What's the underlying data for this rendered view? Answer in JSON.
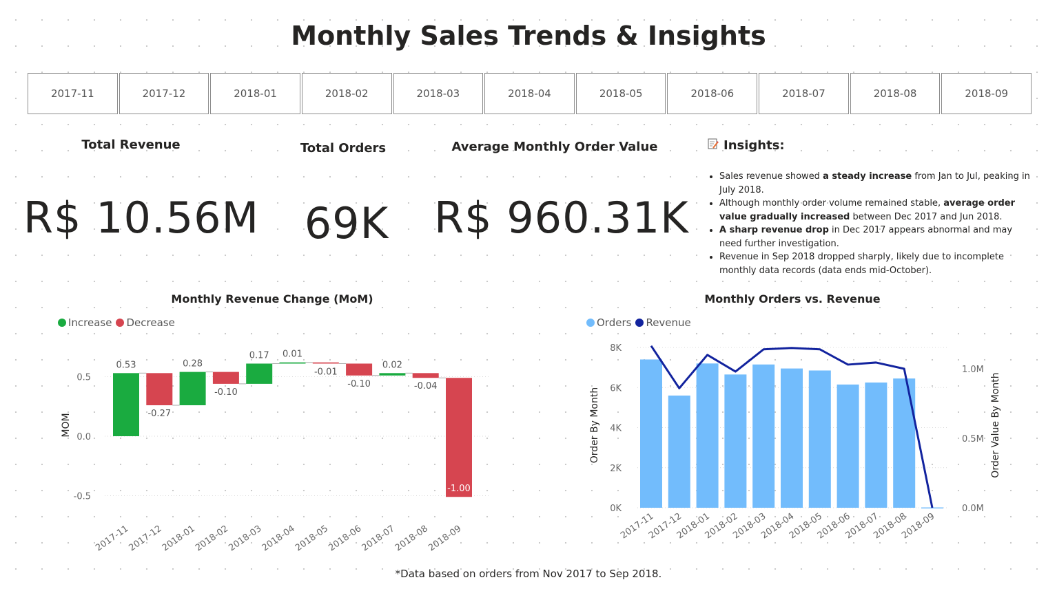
{
  "title": "Monthly Sales Trends & Insights",
  "slicer": [
    "2017-11",
    "2017-12",
    "2018-01",
    "2018-02",
    "2018-03",
    "2018-04",
    "2018-05",
    "2018-06",
    "2018-07",
    "2018-08",
    "2018-09"
  ],
  "kpis": {
    "revenue": {
      "label": "Total Revenue",
      "value": "R$ 10.56M"
    },
    "orders": {
      "label": "Total Orders",
      "value": "69K"
    },
    "aov": {
      "label": "Average Monthly Order Value",
      "value": "R$ 960.31K"
    }
  },
  "insights": {
    "icon": "memo-icon",
    "heading": "Insights:",
    "items": [
      [
        {
          "t": "Sales revenue showed "
        },
        {
          "t": "a steady increase",
          "b": true
        },
        {
          "t": " from Jan to Jul, peaking in July 2018."
        }
      ],
      [
        {
          "t": "Although monthly order volume remained stable, "
        },
        {
          "t": "average order value gradually increased",
          "b": true
        },
        {
          "t": " between Dec 2017 and Jun 2018."
        }
      ],
      [
        {
          "t": "A sharp revenue drop",
          "b": true
        },
        {
          "t": " in Dec 2017 appears abnormal and may need further investigation."
        }
      ],
      [
        {
          "t": "Revenue in Sep 2018 dropped sharply, likely due to incomplete monthly data records (data ends mid-October)."
        }
      ]
    ]
  },
  "footnote": "*Data based on orders from Nov 2017 to Sep 2018.",
  "colors": {
    "increase": "#1AAB40",
    "decrease": "#D64550",
    "orders": "#72BCFC",
    "revenue": "#12239E"
  },
  "chart_data": [
    {
      "type": "bar",
      "subtype": "waterfall",
      "title": "Monthly Revenue Change (MoM)",
      "ylabel": "MOM",
      "legend": [
        "Increase",
        "Decrease"
      ],
      "legend_position": "top-left",
      "categories": [
        "2017-11",
        "2017-12",
        "2018-01",
        "2018-02",
        "2018-03",
        "2018-04",
        "2018-05",
        "2018-06",
        "2018-07",
        "2018-08",
        "2018-09"
      ],
      "values": [
        0.53,
        -0.27,
        0.28,
        -0.1,
        0.17,
        0.01,
        -0.01,
        -0.1,
        0.02,
        -0.04,
        -1.0
      ],
      "data_labels": [
        "0.53",
        "-0.27",
        "0.28",
        "-0.10",
        "0.17",
        "0.01",
        "-0.01",
        "-0.10",
        "0.02",
        "-0.04",
        "-1.00"
      ],
      "yticks": [
        -0.5,
        0.0,
        0.5
      ],
      "ytick_labels": [
        "-0.5",
        "0.0",
        "0.5"
      ],
      "ylim": [
        -0.62,
        0.75
      ],
      "grid": true
    },
    {
      "type": "bar",
      "subtype": "combo-bar-line",
      "title": "Monthly Orders vs. Revenue",
      "legend_position": "top-left",
      "categories": [
        "2017-11",
        "2017-12",
        "2018-01",
        "2018-02",
        "2018-03",
        "2018-04",
        "2018-05",
        "2018-06",
        "2018-07",
        "2018-08",
        "2018-09"
      ],
      "series": [
        {
          "name": "Orders",
          "type": "bar",
          "axis": "left",
          "values": [
            7400,
            5600,
            7200,
            6650,
            7150,
            6950,
            6850,
            6150,
            6250,
            6450,
            16
          ]
        },
        {
          "name": "Revenue",
          "type": "line",
          "axis": "right",
          "values": [
            1165000,
            860000,
            1100000,
            980000,
            1140000,
            1150000,
            1140000,
            1030000,
            1045000,
            1000000,
            0
          ]
        }
      ],
      "ylabel_left": "Order By Month",
      "ylabel_right": "Order Value By Month",
      "yticks_left": [
        0,
        2000,
        4000,
        6000,
        8000
      ],
      "ytick_labels_left": [
        "0K",
        "2K",
        "4K",
        "6K",
        "8K"
      ],
      "ylim_left": [
        0,
        8000
      ],
      "yticks_right": [
        0,
        500000,
        1000000
      ],
      "ytick_labels_right": [
        "0.0M",
        "0.5M",
        "1.0M"
      ],
      "ylim_right": [
        0,
        1150000
      ],
      "grid": true
    }
  ]
}
